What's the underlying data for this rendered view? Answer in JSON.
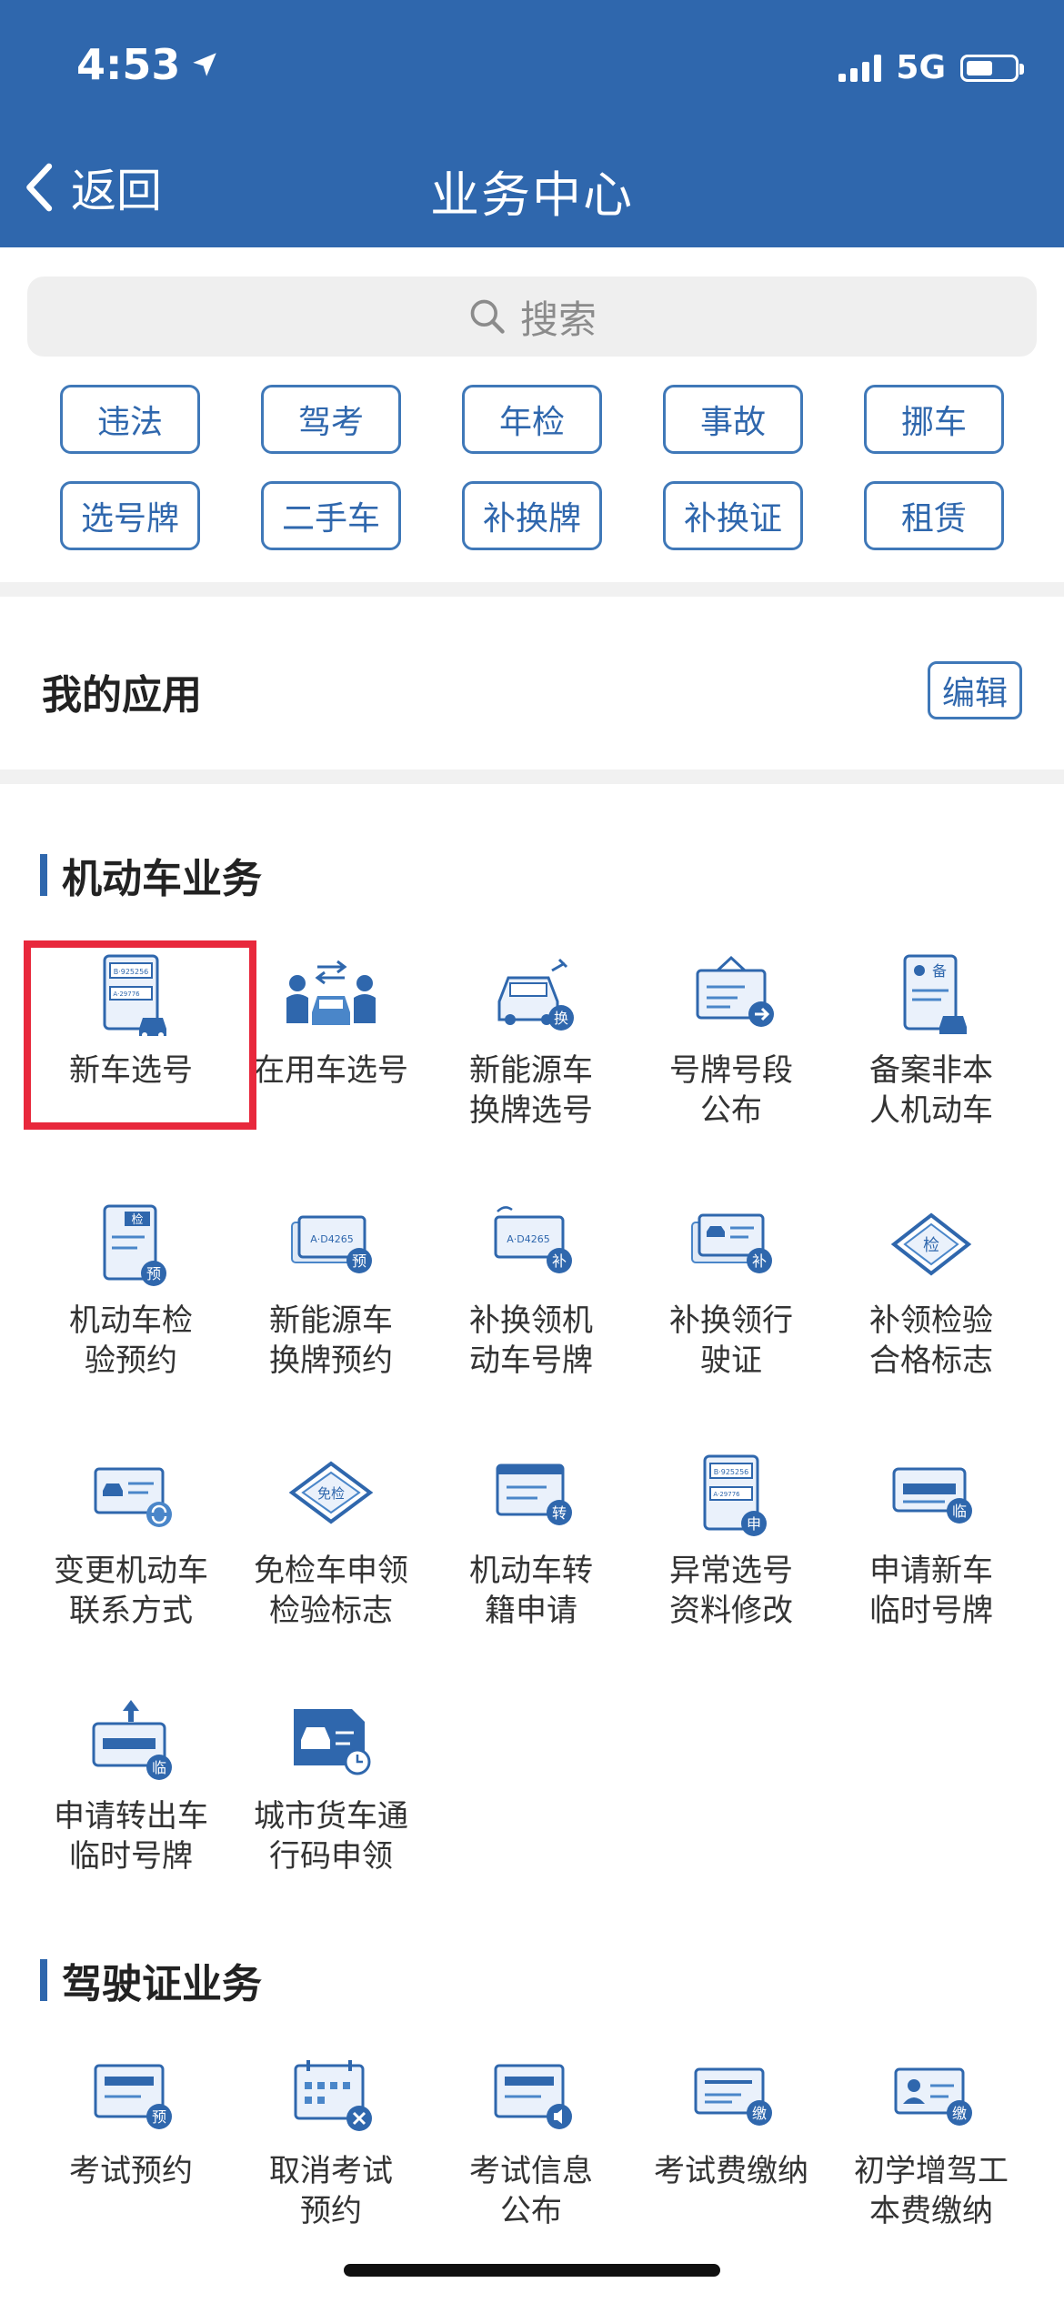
{
  "status": {
    "time": "4:53",
    "network": "5G"
  },
  "nav": {
    "back_label": "返回",
    "title": "业务中心"
  },
  "search": {
    "placeholder": "搜索"
  },
  "tags": [
    "违法",
    "驾考",
    "年检",
    "事故",
    "挪车",
    "选号牌",
    "二手车",
    "补换牌",
    "补换证",
    "租赁"
  ],
  "my_apps": {
    "title": "我的应用",
    "edit_label": "编辑"
  },
  "sections": {
    "vehicle": {
      "title": "机动车业务",
      "items": [
        {
          "line1": "新车选号",
          "line2": "",
          "icon": "plate-doc-car-icon"
        },
        {
          "line1": "在用车选号",
          "line2": "",
          "icon": "two-people-car-icon"
        },
        {
          "line1": "新能源车",
          "line2": "换牌选号",
          "icon": "ev-car-swap-icon"
        },
        {
          "line1": "号牌号段",
          "line2": "公布",
          "icon": "notice-board-icon"
        },
        {
          "line1": "备案非本",
          "line2": "人机动车",
          "icon": "registration-doc-icon"
        },
        {
          "line1": "机动车检",
          "line2": "验预约",
          "icon": "inspection-reserve-icon"
        },
        {
          "line1": "新能源车",
          "line2": "换牌预约",
          "icon": "ev-plate-reserve-icon"
        },
        {
          "line1": "补换领机",
          "line2": "动车号牌",
          "icon": "plate-replace-icon"
        },
        {
          "line1": "补换领行",
          "line2": "驶证",
          "icon": "license-replace-icon"
        },
        {
          "line1": "补领检验",
          "line2": "合格标志",
          "icon": "inspection-diamond-icon"
        },
        {
          "line1": "变更机动车",
          "line2": "联系方式",
          "icon": "contact-change-icon"
        },
        {
          "line1": "免检车申领",
          "line2": "检验标志",
          "icon": "exempt-diamond-icon"
        },
        {
          "line1": "机动车转",
          "line2": "籍申请",
          "icon": "transfer-doc-icon"
        },
        {
          "line1": "异常选号",
          "line2": "资料修改",
          "icon": "abnormal-plate-icon"
        },
        {
          "line1": "申请新车",
          "line2": "临时号牌",
          "icon": "temp-plate-icon"
        },
        {
          "line1": "申请转出车",
          "line2": "临时号牌",
          "icon": "temp-plate-out-icon"
        },
        {
          "line1": "城市货车通",
          "line2": "行码申领",
          "icon": "truck-pass-icon"
        }
      ],
      "badges": {
        "change": "换",
        "reserve": "预",
        "replace": "补",
        "inspect": "检",
        "exempt": "免检",
        "transfer": "转",
        "apply": "申",
        "temp": "临",
        "record": "备",
        "plate_a": "A·D4265",
        "plate_b": "B·925256",
        "plate_c": "A·29776"
      }
    },
    "license": {
      "title": "驾驶证业务",
      "items": [
        {
          "line1": "考试预约",
          "line2": "",
          "icon": "exam-reserve-icon"
        },
        {
          "line1": "取消考试",
          "line2": "预约",
          "icon": "exam-cancel-icon"
        },
        {
          "line1": "考试信息",
          "line2": "公布",
          "icon": "exam-info-icon"
        },
        {
          "line1": "考试费缴纳",
          "line2": "",
          "icon": "exam-fee-icon"
        },
        {
          "line1": "初学增驾工",
          "line2": "本费缴纳",
          "icon": "learner-fee-icon"
        }
      ],
      "badges": {
        "reserve": "预",
        "pay": "缴"
      }
    }
  },
  "colors": {
    "primary": "#2f67ad",
    "accent": "#3f78b8",
    "highlight": "#e8283c"
  }
}
